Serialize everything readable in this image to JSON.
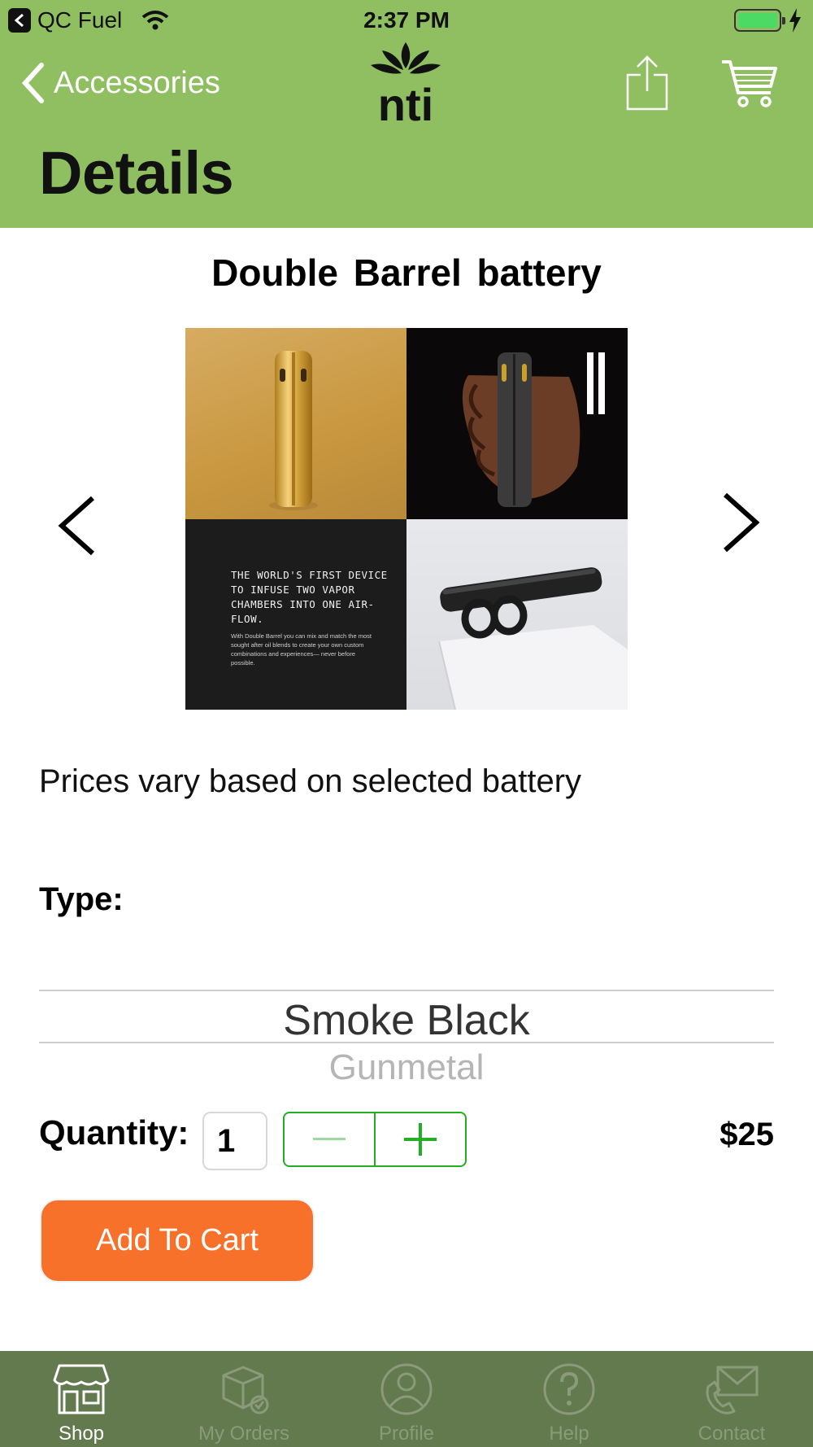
{
  "status_bar": {
    "carrier": "QC Fuel",
    "time": "2:37 PM"
  },
  "header": {
    "back_label": "Accessories",
    "title": "Details",
    "logo_text": "nti"
  },
  "product": {
    "name": "Double Barrel battery",
    "price_note": "Prices vary based on selected battery",
    "price": "$25"
  },
  "gallery": {
    "tile3_headline": "THE WORLD'S FIRST DEVICE TO INFUSE TWO VAPOR CHAMBERS INTO ONE AIR-FLOW.",
    "tile3_body": "With Double Barrel you can mix and match the most sought after oil blends to create your own custom combinations and experiences— never before possible."
  },
  "type_picker": {
    "label": "Type:",
    "selected": "Smoke Black",
    "next_option": "Gunmetal"
  },
  "quantity": {
    "label": "Quantity:",
    "value": "1"
  },
  "add_to_cart_label": "Add To Cart",
  "tabs": [
    {
      "label": "Shop",
      "icon": "store-icon",
      "active": true
    },
    {
      "label": "My Orders",
      "icon": "orders-box-icon",
      "active": false
    },
    {
      "label": "Profile",
      "icon": "person-icon",
      "active": false
    },
    {
      "label": "Help",
      "icon": "question-icon",
      "active": false
    },
    {
      "label": "Contact",
      "icon": "envelope-phone-icon",
      "active": false
    }
  ],
  "colors": {
    "header_green": "#8fbf61",
    "tabbar_green": "#63794e",
    "button_orange": "#f8712a",
    "stepper_green": "#22b022"
  }
}
